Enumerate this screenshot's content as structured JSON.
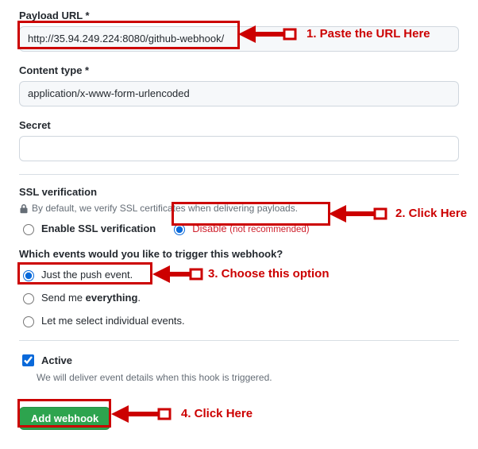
{
  "payload": {
    "label": "Payload URL *",
    "value": "http://35.94.249.224:8080/github-webhook/"
  },
  "content_type": {
    "label": "Content type *",
    "value": "application/x-www-form-urlencoded"
  },
  "secret": {
    "label": "Secret",
    "value": ""
  },
  "ssl": {
    "title": "SSL verification",
    "help": "By default, we verify SSL certificates when delivering payloads.",
    "enable_label": "Enable SSL verification",
    "disable_label": "Disable",
    "disable_note": "(not recommended)"
  },
  "events": {
    "title": "Which events would you like to trigger this webhook?",
    "push_pre": "Just the ",
    "push_word": "push",
    "push_post": " event.",
    "everything_pre": "Send me ",
    "everything_word": "everything",
    "everything_post": ".",
    "individual": "Let me select individual events."
  },
  "active": {
    "label": "Active",
    "help": "We will deliver event details when this hook is triggered."
  },
  "submit": {
    "label": "Add webhook"
  },
  "annotations": {
    "a1": "1. Paste the URL Here",
    "a2": "2. Click Here",
    "a3": "3. Choose this option",
    "a4": "4. Click Here"
  }
}
